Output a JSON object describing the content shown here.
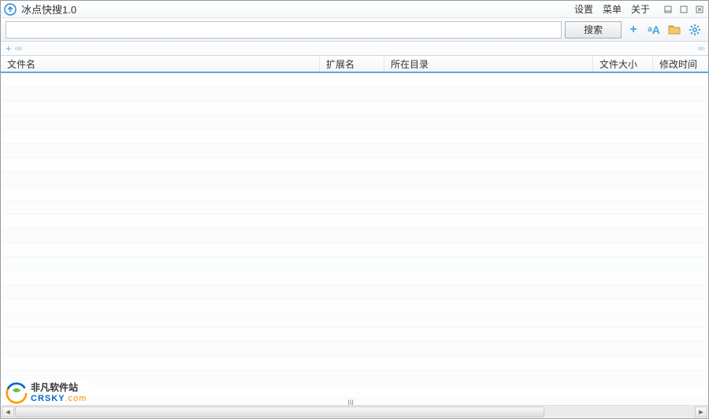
{
  "app": {
    "title": "冰点快搜1.0"
  },
  "menu": {
    "settings": "设置",
    "menu": "菜单",
    "about": "关于"
  },
  "toolbar": {
    "search_value": "",
    "search_placeholder": "",
    "search_button": "搜索"
  },
  "tabs": {
    "add": "+",
    "prev": "««",
    "next": "»»"
  },
  "columns": {
    "name": "文件名",
    "ext": "扩展名",
    "dir": "所在目录",
    "size": "文件大小",
    "mtime": "修改时间"
  },
  "rows": [],
  "scroll": {
    "marker": "III"
  },
  "watermark": {
    "line1": "非凡软件站",
    "line2a": "CRSKY",
    "line2b": ".com"
  }
}
